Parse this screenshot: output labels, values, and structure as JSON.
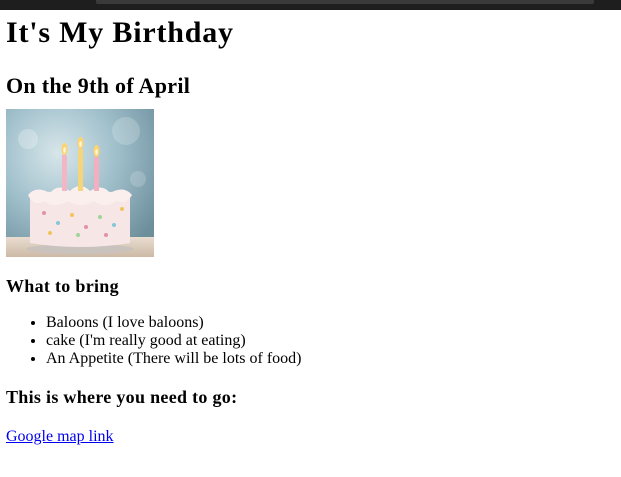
{
  "page": {
    "title": "It's My Birthday",
    "subtitle": "On the 9th of April",
    "image_alt": "birthday-cake-with-candles",
    "bring_heading": "What to bring",
    "bring_items": [
      "Baloons (I love baloons)",
      "cake (I'm really good at eating)",
      "An Appetite (There will be lots of food)"
    ],
    "location_heading": "This is where you need to go:",
    "map_link": "Google map link"
  },
  "colors": {
    "link": "#0000ee",
    "topbar": "#1e1e1e"
  }
}
